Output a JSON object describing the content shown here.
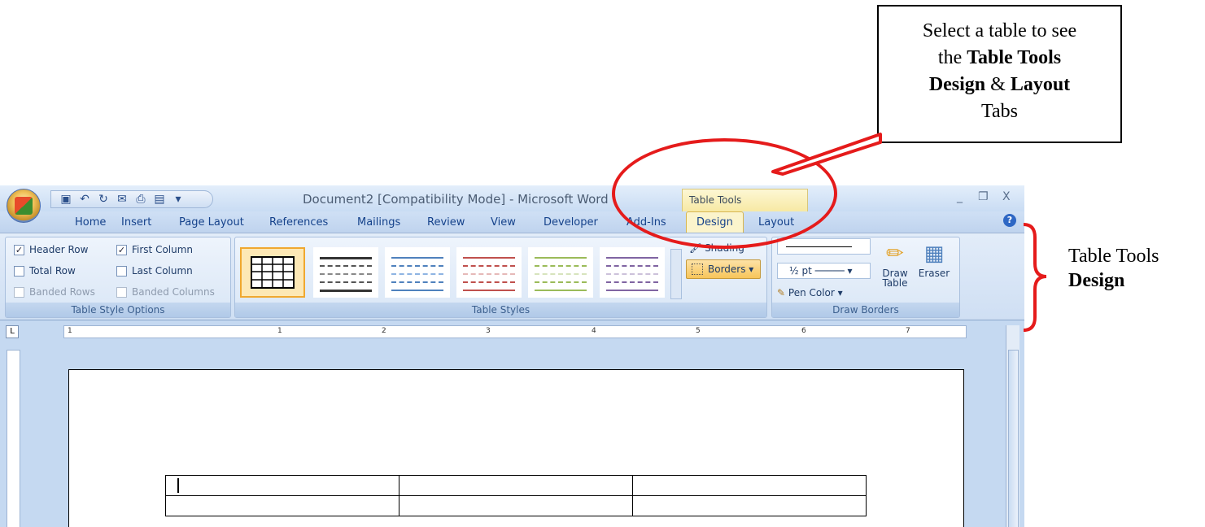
{
  "callout": {
    "line1": "Select a table to see",
    "line2_pre": "the ",
    "line2_bold": "Table Tools",
    "line3_bold1": "Design",
    "line3_mid": " & ",
    "line3_bold2": "Layout",
    "line4": "Tabs"
  },
  "side_label": {
    "line1": "Table Tools",
    "line2": "Design"
  },
  "window": {
    "title": "Document2 [Compatibility Mode] - Microsoft Word",
    "context_group": "Table Tools",
    "controls": {
      "minimize": "_",
      "restore": "❐",
      "close": "X"
    },
    "tabs": [
      "Home",
      "Insert",
      "Page Layout",
      "References",
      "Mailings",
      "Review",
      "View",
      "Developer",
      "Add-Ins",
      "Design",
      "Layout"
    ],
    "active_tab": "Design",
    "help": "?"
  },
  "ribbon": {
    "style_options": {
      "label": "Table Style Options",
      "header_row": "Header Row",
      "first_column": "First Column",
      "total_row": "Total Row",
      "last_column": "Last Column",
      "banded_rows": "Banded Rows",
      "banded_columns": "Banded Columns",
      "checked_mark": "✓"
    },
    "table_styles": {
      "label": "Table Styles",
      "shading": "Shading",
      "borders": "Borders"
    },
    "draw_borders": {
      "label": "Draw Borders",
      "pen_weight": "½ pt",
      "pen_color": "Pen Color ▾",
      "draw_table_1": "Draw",
      "draw_table_2": "Table",
      "eraser": "Eraser"
    }
  },
  "ruler_numbers": [
    "1",
    "1",
    "2",
    "3",
    "4",
    "5",
    "6",
    "7"
  ],
  "colors": {
    "annotation_red": "#e51b1b",
    "ribbon_blue": "#c5d9f1",
    "active_tab": "#fbf4cc"
  }
}
